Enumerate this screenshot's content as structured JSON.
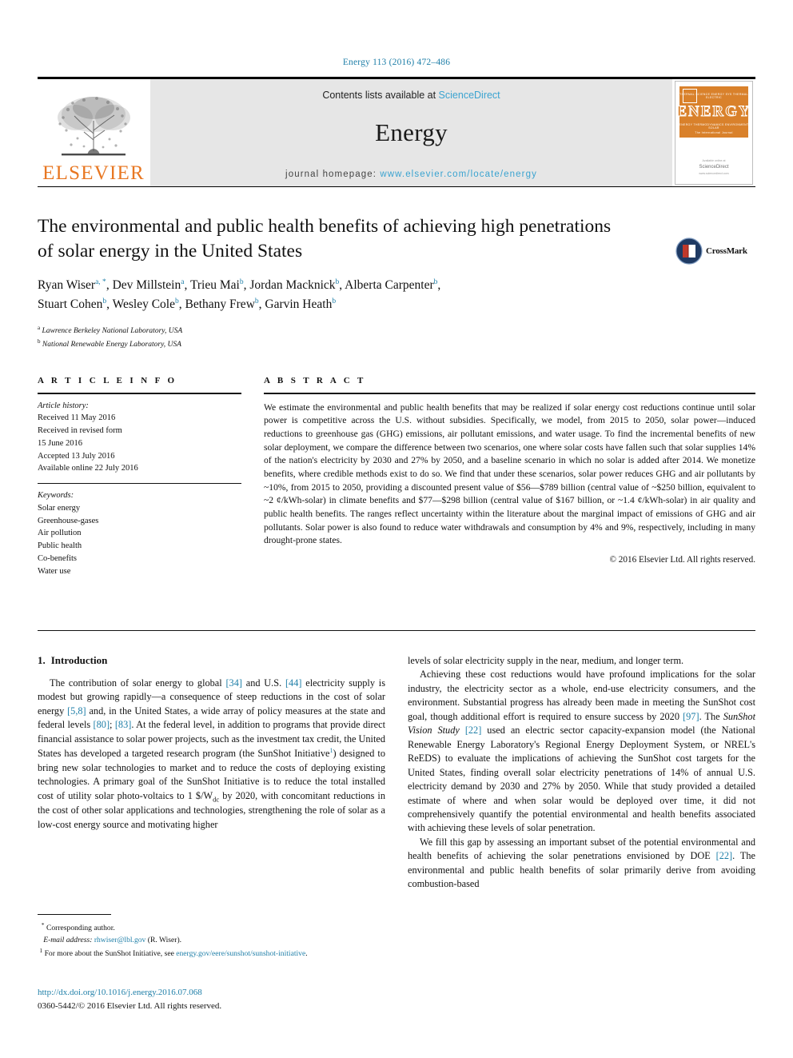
{
  "running_head": "Energy 113 (2016) 472–486",
  "masthead": {
    "contents_prefix": "Contents lists available at ",
    "sciencedirect": "ScienceDirect",
    "journal_name": "Energy",
    "homepage_label": "journal homepage: ",
    "homepage_url": "www.elsevier.com/locate/energy",
    "publisher": "ELSEVIER",
    "cover": {
      "title": "ENERGY",
      "tagline": "The International Journal",
      "top_right": "ISSN 0360-5442",
      "row1": "THERMAL SCIENCE     ENERGY SYS     THERMAL     ELECTRIC",
      "row2": "ENERGY     THERMODYNAMICS     ENVIRONMENT     SOLAR",
      "foot_small": "Available online at",
      "foot_big": "ScienceDirect",
      "foot_url": "www.sciencedirect.com"
    }
  },
  "article": {
    "title": "The environmental and public health benefits of achieving high penetrations of solar energy in the United States",
    "authors": [
      {
        "name": "Ryan Wiser",
        "marks": "a, *",
        "sep": ", "
      },
      {
        "name": "Dev Millstein",
        "marks": "a",
        "sep": ", "
      },
      {
        "name": "Trieu Mai",
        "marks": "b",
        "sep": ", "
      },
      {
        "name": "Jordan Macknick",
        "marks": "b",
        "sep": ", "
      },
      {
        "name": "Alberta Carpenter",
        "marks": "b",
        "sep": ", "
      },
      {
        "name": "Stuart Cohen",
        "marks": "b",
        "sep": ", "
      },
      {
        "name": "Wesley Cole",
        "marks": "b",
        "sep": ", "
      },
      {
        "name": "Bethany Frew",
        "marks": "b",
        "sep": ", "
      },
      {
        "name": "Garvin Heath",
        "marks": "b",
        "sep": ""
      }
    ],
    "affiliations": [
      {
        "mark": "a",
        "text": "Lawrence Berkeley National Laboratory, USA"
      },
      {
        "mark": "b",
        "text": "National Renewable Energy Laboratory, USA"
      }
    ],
    "crossmark_label": "CrossMark"
  },
  "info": {
    "heading": "A R T I C L E   I N F O",
    "history_label": "Article history:",
    "history": [
      "Received 11 May 2016",
      "Received in revised form",
      "15 June 2016",
      "Accepted 13 July 2016",
      "Available online 22 July 2016"
    ],
    "keywords_label": "Keywords:",
    "keywords": [
      "Solar energy",
      "Greenhouse-gases",
      "Air pollution",
      "Public health",
      "Co-benefits",
      "Water use"
    ]
  },
  "abstract": {
    "heading": "A B S T R A C T",
    "text": "We estimate the environmental and public health benefits that may be realized if solar energy cost reductions continue until solar power is competitive across the U.S. without subsidies. Specifically, we model, from 2015 to 2050, solar power—induced reductions to greenhouse gas (GHG) emissions, air pollutant emissions, and water usage. To find the incremental benefits of new solar deployment, we compare the difference between two scenarios, one where solar costs have fallen such that solar supplies 14% of the nation's electricity by 2030 and 27% by 2050, and a baseline scenario in which no solar is added after 2014. We monetize benefits, where credible methods exist to do so. We find that under these scenarios, solar power reduces GHG and air pollutants by ~10%, from 2015 to 2050, providing a discounted present value of $56—$789 billion (central value of ~$250 billion, equivalent to ~2 ¢/kWh-solar) in climate benefits and $77—$298 billion (central value of $167 billion, or ~1.4 ¢/kWh-solar) in air quality and public health benefits. The ranges reflect uncertainty within the literature about the marginal impact of emissions of GHG and air pollutants. Solar power is also found to reduce water withdrawals and consumption by 4% and 9%, respectively, including in many drought-prone states.",
    "copyright": "© 2016 Elsevier Ltd. All rights reserved."
  },
  "introduction": {
    "number": "1.",
    "heading": "Introduction",
    "left_paragraph_1": {
      "s1": "The contribution of solar energy to global ",
      "c1": "[34]",
      "s2": " and U.S. ",
      "c2": "[44]",
      "s3": " electricity supply is modest but growing rapidly—a consequence of steep reductions in the cost of solar energy ",
      "c3": "[5,8]",
      "s4": " and, in the United States, a wide array of policy measures at the state and federal levels ",
      "c4": "[80]",
      "s5": "; ",
      "c5": "[83]",
      "s6": ". At the federal level, in addition to programs that provide direct financial assistance to solar power projects, such as the investment tax credit, the United States has developed a targeted research program (the SunShot Initiative",
      "fn": "1",
      "s7": ") designed to bring new solar technologies to market and to reduce the costs of deploying existing technologies. A primary goal of the SunShot Initiative is to reduce the total installed cost of utility solar photo-voltaics to 1 $/W",
      "sub": "dc",
      "s8": " by 2020, with concomitant reductions in the cost of other solar applications and technologies, strengthening the role of solar as a low-cost energy source and motivating higher"
    },
    "right_continuation": "levels of solar electricity supply in the near, medium, and longer term.",
    "right_paragraph_1": {
      "s1": "Achieving these cost reductions would have profound implications for the solar industry, the electricity sector as a whole, end-use electricity consumers, and the environment. Substantial progress has already been made in meeting the SunShot cost goal, though additional effort is required to ensure success by 2020 ",
      "c1": "[97]",
      "s2": ". The ",
      "i1": "SunShot Vision Study",
      "s3": " ",
      "c2": "[22]",
      "s4": " used an electric sector capacity-expansion model (the National Renewable Energy Laboratory's Regional Energy Deployment System, or NREL's ReEDS) to evaluate the implications of achieving the SunShot cost targets for the United States, finding overall solar electricity penetrations of 14% of annual U.S. electricity demand by 2030 and 27% by 2050. While that study provided a detailed estimate of where and when solar would be deployed over time, it did not comprehensively quantify the potential environmental and health benefits associated with achieving these levels of solar penetration."
    },
    "right_paragraph_2": {
      "s1": "We fill this gap by assessing an important subset of the potential environmental and health benefits of achieving the solar penetrations envisioned by DOE ",
      "c1": "[22]",
      "s2": ". The environmental and public health benefits of solar primarily derive from avoiding combustion-based"
    }
  },
  "footnotes": {
    "corresponding_mark": "*",
    "corresponding_text": "Corresponding author.",
    "email_label": "E-mail address:",
    "email": "rhwiser@lbl.gov",
    "email_owner": "(R. Wiser).",
    "fn1_mark": "1",
    "fn1_text": "For more about the SunShot Initiative, see ",
    "fn1_link": "energy.gov/eere/sunshot/sunshot-initiative",
    "fn1_tail": "."
  },
  "bottom": {
    "doi": "http://dx.doi.org/10.1016/j.energy.2016.07.068",
    "issn": "0360-5442/© 2016 Elsevier Ltd. All rights reserved."
  },
  "colors": {
    "link": "#1f7fa8",
    "sciencedirect": "#3aa3d0",
    "elsevier_orange": "#E87722",
    "masthead_gray": "#e6e6e6"
  }
}
